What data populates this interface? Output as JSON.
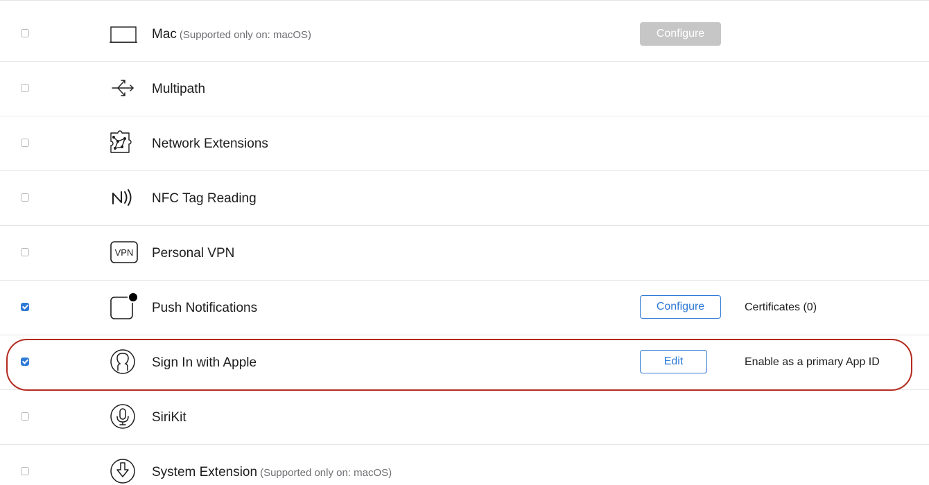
{
  "capabilities": [
    {
      "name": "Mac",
      "note": "(Supported only on: macOS)",
      "checked": false,
      "icon": "mac-icon",
      "button": "Configure",
      "button_state": "disabled",
      "side_text": ""
    },
    {
      "name": "Multipath",
      "note": "",
      "checked": false,
      "icon": "multipath-icon",
      "button": "",
      "button_state": "",
      "side_text": ""
    },
    {
      "name": "Network Extensions",
      "note": "",
      "checked": false,
      "icon": "network-extensions-icon",
      "button": "",
      "button_state": "",
      "side_text": ""
    },
    {
      "name": "NFC Tag Reading",
      "note": "",
      "checked": false,
      "icon": "nfc-icon",
      "button": "",
      "button_state": "",
      "side_text": ""
    },
    {
      "name": "Personal VPN",
      "note": "",
      "checked": false,
      "icon": "vpn-icon",
      "icon_text": "VPN",
      "button": "",
      "button_state": "",
      "side_text": ""
    },
    {
      "name": "Push Notifications",
      "note": "",
      "checked": true,
      "icon": "push-notifications-icon",
      "button": "Configure",
      "button_state": "enabled",
      "side_text": "Certificates (0)"
    },
    {
      "name": "Sign In with Apple",
      "note": "",
      "checked": true,
      "icon": "sign-in-with-apple-icon",
      "button": "Edit",
      "button_state": "enabled",
      "side_text": "Enable as a primary App ID",
      "highlighted": true
    },
    {
      "name": "SiriKit",
      "note": "",
      "checked": false,
      "icon": "microphone-icon",
      "button": "",
      "button_state": "",
      "side_text": ""
    },
    {
      "name": "System Extension",
      "note": "(Supported only on: macOS)",
      "checked": false,
      "icon": "system-extension-icon",
      "button": "",
      "button_state": "",
      "side_text": ""
    }
  ],
  "colors": {
    "accent": "#2f7ad7",
    "highlight_border": "#b42a1e",
    "disabled_button": "#c6c6c6",
    "divider": "#e5e5e5"
  }
}
